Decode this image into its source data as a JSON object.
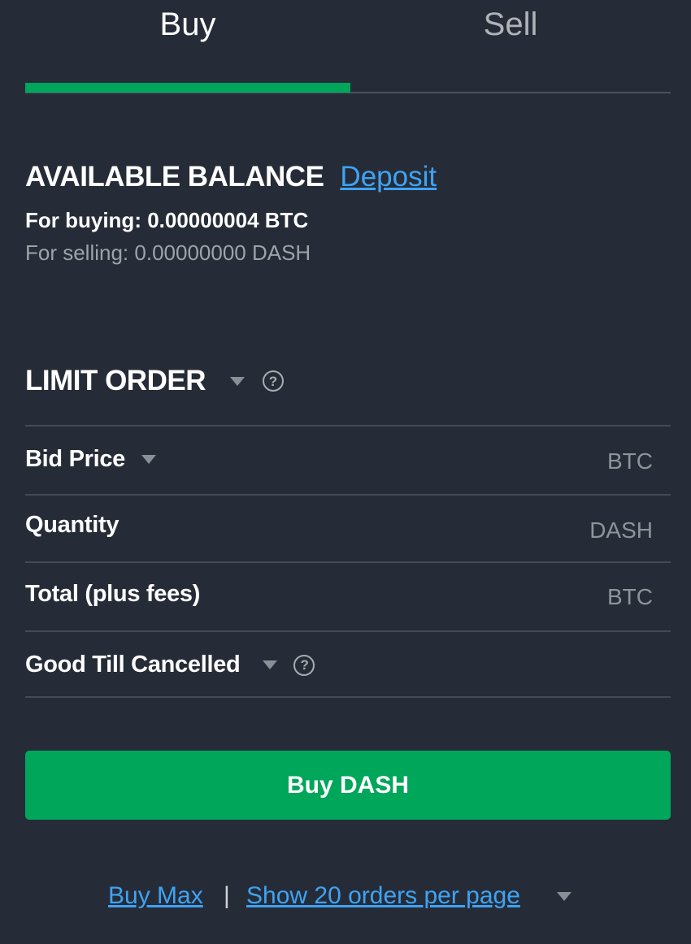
{
  "tabs": {
    "buy": "Buy",
    "sell": "Sell"
  },
  "balance": {
    "title": "AVAILABLE BALANCE",
    "deposit": "Deposit",
    "for_buying": "For buying: 0.00000004 BTC",
    "for_selling": "For selling: 0.00000000 DASH"
  },
  "order": {
    "type": "LIMIT ORDER",
    "help_glyph": "?"
  },
  "fields": {
    "bid_price": {
      "label": "Bid Price",
      "unit": "BTC"
    },
    "quantity": {
      "label": "Quantity",
      "unit": "DASH"
    },
    "total": {
      "label": "Total (plus fees)",
      "unit": "BTC"
    },
    "time_in_force": {
      "label": "Good Till Cancelled",
      "help_glyph": "?"
    }
  },
  "actions": {
    "buy_button": "Buy DASH",
    "buy_max": "Buy Max",
    "separator": "|",
    "orders_per_page": "Show 20 orders per page"
  },
  "colors": {
    "background": "#262c37",
    "accent_green": "#00a65a",
    "link_blue": "#3ea3f5",
    "muted_text": "#9ea2a9"
  }
}
